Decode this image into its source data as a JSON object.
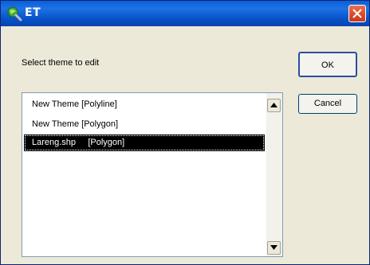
{
  "window": {
    "title": "ET",
    "app_icon": "magnifier-globe-icon",
    "close_icon": "close-icon"
  },
  "dialog": {
    "prompt": "Select theme to edit",
    "ok_label": "OK",
    "cancel_label": "Cancel"
  },
  "themes": {
    "items": [
      {
        "label": "New Theme [Polyline]",
        "selected": false
      },
      {
        "label": "New Theme [Polygon]",
        "selected": false
      },
      {
        "label": "Lareng.shp     [Polygon]",
        "selected": true
      }
    ]
  },
  "colors": {
    "titlebar": "#0a5fd8",
    "close_button": "#d9482a",
    "selection": "#000000",
    "dialog_bg": "#ece9d8"
  }
}
